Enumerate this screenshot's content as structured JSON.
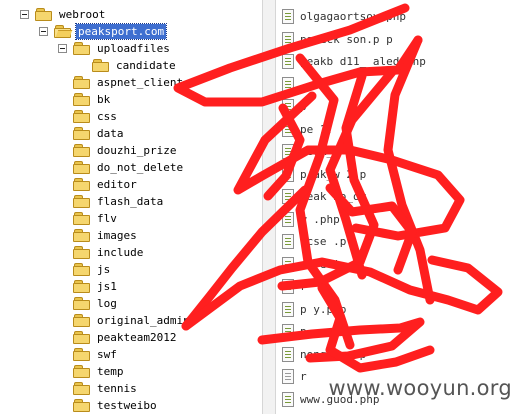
{
  "tree": {
    "root": {
      "label": "webroot",
      "icon": "folder-icon"
    },
    "site": {
      "label": "peaksport.com",
      "icon": "folder-open-icon",
      "selected": true
    },
    "uploadfiles": {
      "label": "uploadfiles",
      "icon": "folder-icon"
    },
    "candidate": {
      "label": "candidate",
      "icon": "folder-icon"
    },
    "folders": [
      "aspnet_client",
      "bk",
      "css",
      "data",
      "douzhi_prize",
      "do_not_delete",
      "editor",
      "flash_data",
      "flv",
      "images",
      "include",
      "js",
      "js1",
      "log",
      "original_admin",
      "peakteam2012",
      "swf",
      "temp",
      "tennis",
      "testweibo"
    ]
  },
  "files": [
    {
      "name": "olgagaortsov.php",
      "icon": "php-file-icon"
    },
    {
      "name": "pa ick   son.p p",
      "icon": "php-file-icon"
    },
    {
      "name": "peakb    d11_  aled.php",
      "icon": "php-file-icon"
    },
    {
      "name": "",
      "icon": "php-file-icon"
    },
    {
      "name": "p",
      "icon": "php-file-icon"
    },
    {
      "name": "pe    1.",
      "icon": "php-file-icon"
    },
    {
      "name": "peak_w    .p",
      "icon": "php-file-icon"
    },
    {
      "name": "p ak_w   2 p",
      "icon": "php-file-icon"
    },
    {
      "name": "peak    bo_or",
      "icon": "php-file-icon"
    },
    {
      "name": "    w    .php",
      "icon": "php-file-icon"
    },
    {
      "name": "    ocse  .p",
      "icon": "php-file-icon"
    },
    {
      "name": "  st   eri",
      "icon": "php-file-icon"
    },
    {
      "name": "  r",
      "icon": "php-file-icon"
    },
    {
      "name": "p    y.php",
      "icon": "php-file-icon"
    },
    {
      "name": "p",
      "icon": "php-file-icon"
    },
    {
      "name": "nongyu.php",
      "icon": "php-file-icon"
    },
    {
      "name": "r",
      "icon": "text-file-icon"
    },
    {
      "name": "www.guod.php",
      "icon": "php-file-icon"
    }
  ],
  "watermark": "www.wooyun.org",
  "colors": {
    "selection": "#3f6fd0",
    "scribble": "#ff1f1f",
    "folder": "#f5d66e"
  }
}
